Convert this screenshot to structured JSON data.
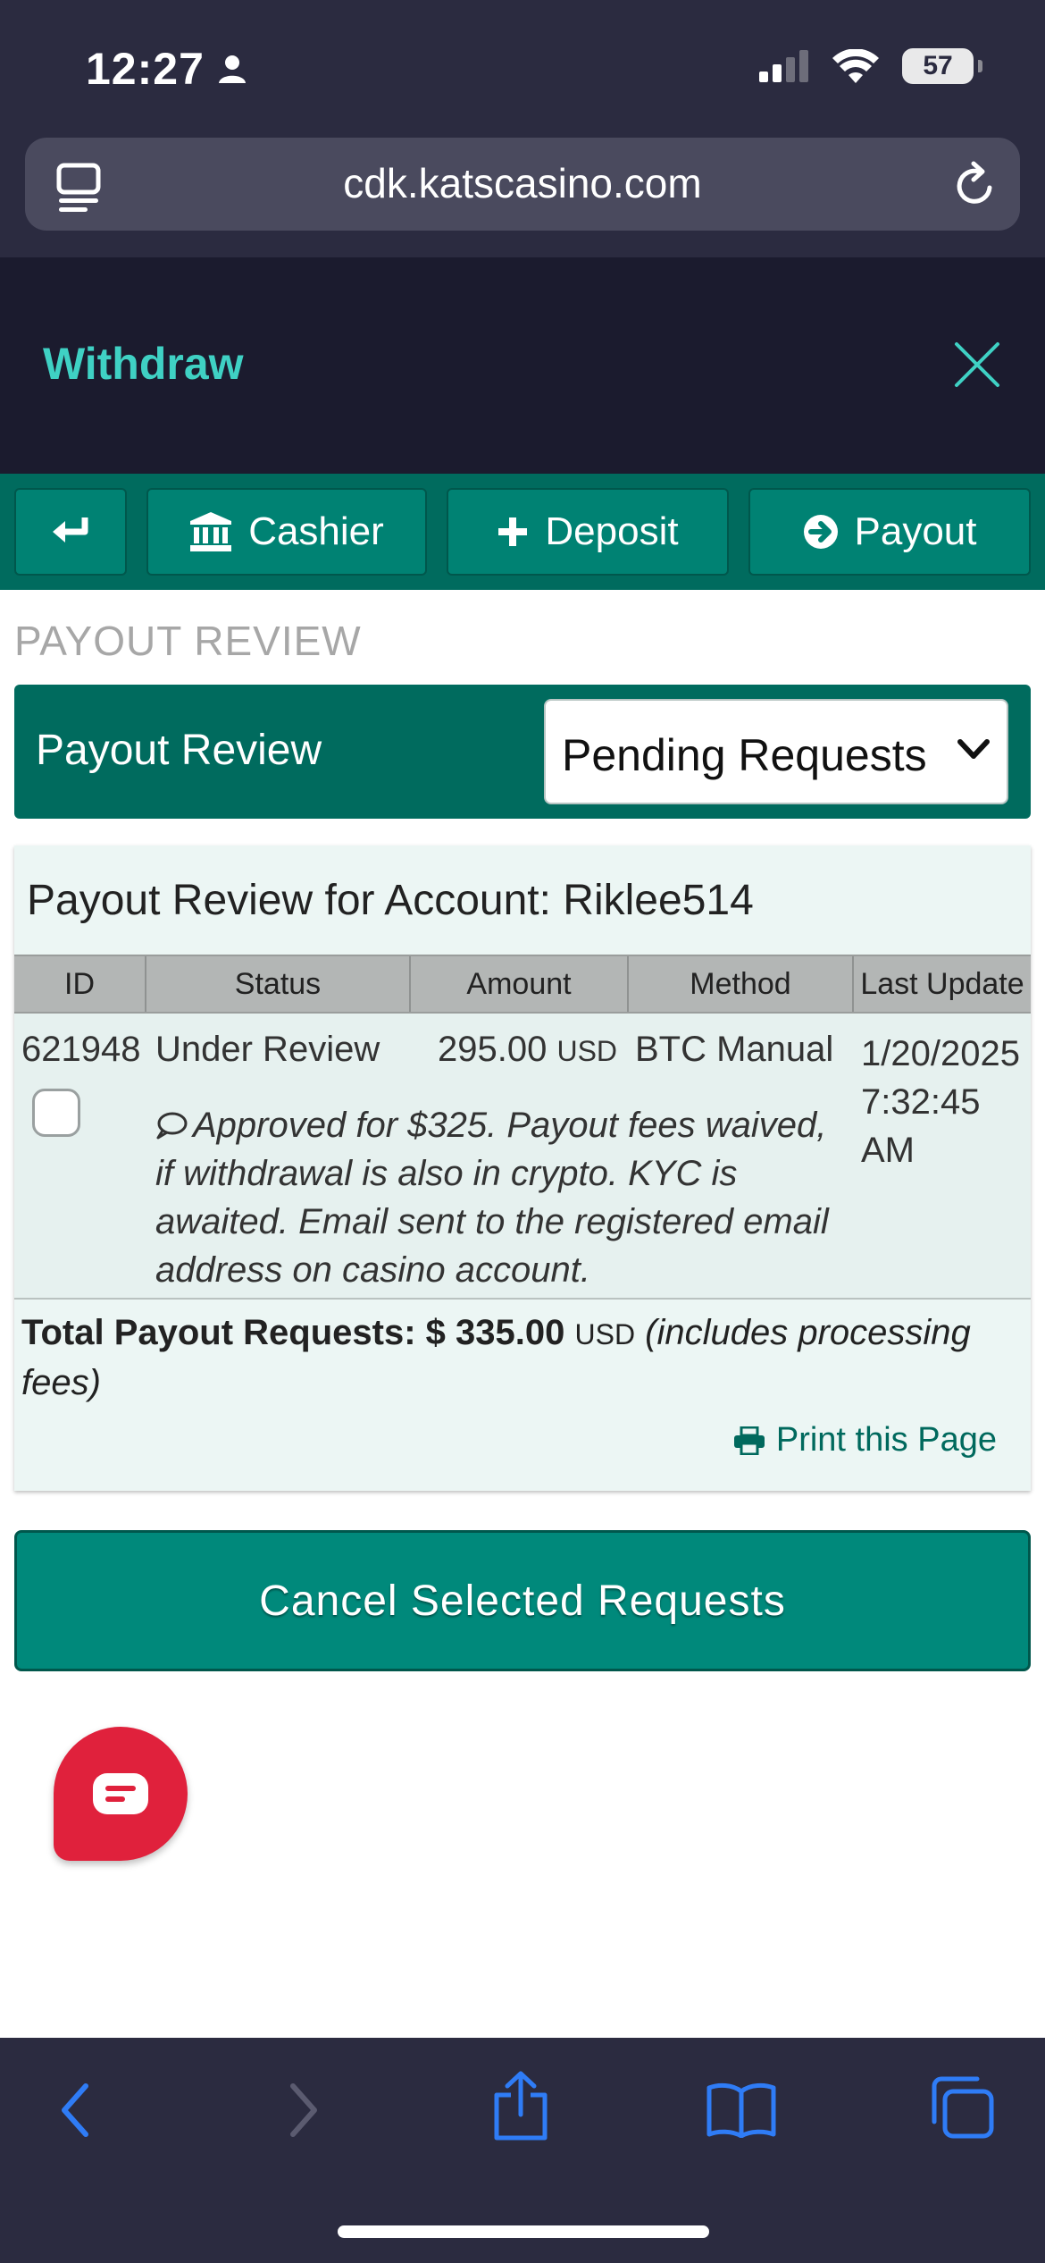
{
  "status_bar": {
    "time": "12:27",
    "battery": "57"
  },
  "browser": {
    "url": "cdk.katscasino.com"
  },
  "header": {
    "title": "Withdraw"
  },
  "nav": {
    "cashier": "Cashier",
    "deposit": "Deposit",
    "payout": "Payout"
  },
  "section_heading": "PAYOUT REVIEW",
  "review_bar": {
    "title": "Payout Review",
    "filter_selected": "Pending Requests"
  },
  "panel": {
    "title": "Payout Review for Account: Riklee514",
    "columns": [
      "ID",
      "Status",
      "Amount",
      "Method",
      "Last Update"
    ],
    "rows": [
      {
        "id": "621948",
        "status": "Under Review",
        "amount": "295.00",
        "currency": "USD",
        "method": "BTC Manual",
        "date": "1/20/2025",
        "time": "7:32:45",
        "ampm": "AM",
        "note": "Approved for $325. Payout fees waived, if withdrawal is also in crypto. KYC is awaited. Email sent to the registered email address on casino account.",
        "selected": false
      }
    ],
    "total_label": "Total Payout Requests: $ 335.00",
    "total_currency": "USD",
    "total_note": "(includes processing fees)",
    "print_label": "Print this Page"
  },
  "cancel_button": "Cancel Selected Requests",
  "colors": {
    "brand_green": "#006b5e",
    "button_green": "#00897b",
    "accent_teal": "#3fd1c4",
    "chat_red": "#e0213c",
    "ios_blue": "#2f7cf6"
  }
}
